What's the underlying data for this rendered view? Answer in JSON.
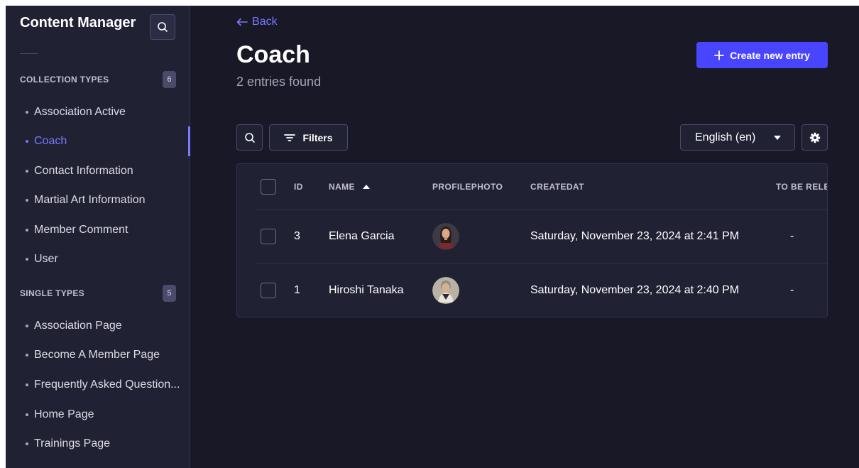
{
  "sidebar": {
    "title": "Content Manager",
    "collection_types": {
      "label": "COLLECTION TYPES",
      "count": "6",
      "items": [
        {
          "label": "Association Active"
        },
        {
          "label": "Coach"
        },
        {
          "label": "Contact Information"
        },
        {
          "label": "Martial Art Information"
        },
        {
          "label": "Member Comment"
        },
        {
          "label": "User"
        }
      ]
    },
    "single_types": {
      "label": "SINGLE TYPES",
      "count": "5",
      "items": [
        {
          "label": "Association Page"
        },
        {
          "label": "Become A Member Page"
        },
        {
          "label": "Frequently Asked Question..."
        },
        {
          "label": "Home Page"
        },
        {
          "label": "Trainings Page"
        }
      ]
    }
  },
  "header": {
    "back_label": "Back",
    "title": "Coach",
    "subtitle": "2 entries found",
    "create_label": "Create new entry"
  },
  "toolbar": {
    "filters_label": "Filters",
    "locale": "English (en)"
  },
  "table": {
    "columns": [
      "ID",
      "NAME",
      "PROFILEPHOTO",
      "CREATEDAT",
      "TO BE RELE"
    ],
    "rows": [
      {
        "id": "3",
        "name": "Elena Garcia",
        "createdat": "Saturday, November 23, 2024 at 2:41 PM",
        "status": "-"
      },
      {
        "id": "1",
        "name": "Hiroshi Tanaka",
        "createdat": "Saturday, November 23, 2024 at 2:40 PM",
        "status": "-"
      }
    ]
  },
  "colors": {
    "background": "#181826",
    "sidebar": "#212134",
    "primary": "#4945ff",
    "accent_text": "#7b79ff"
  }
}
